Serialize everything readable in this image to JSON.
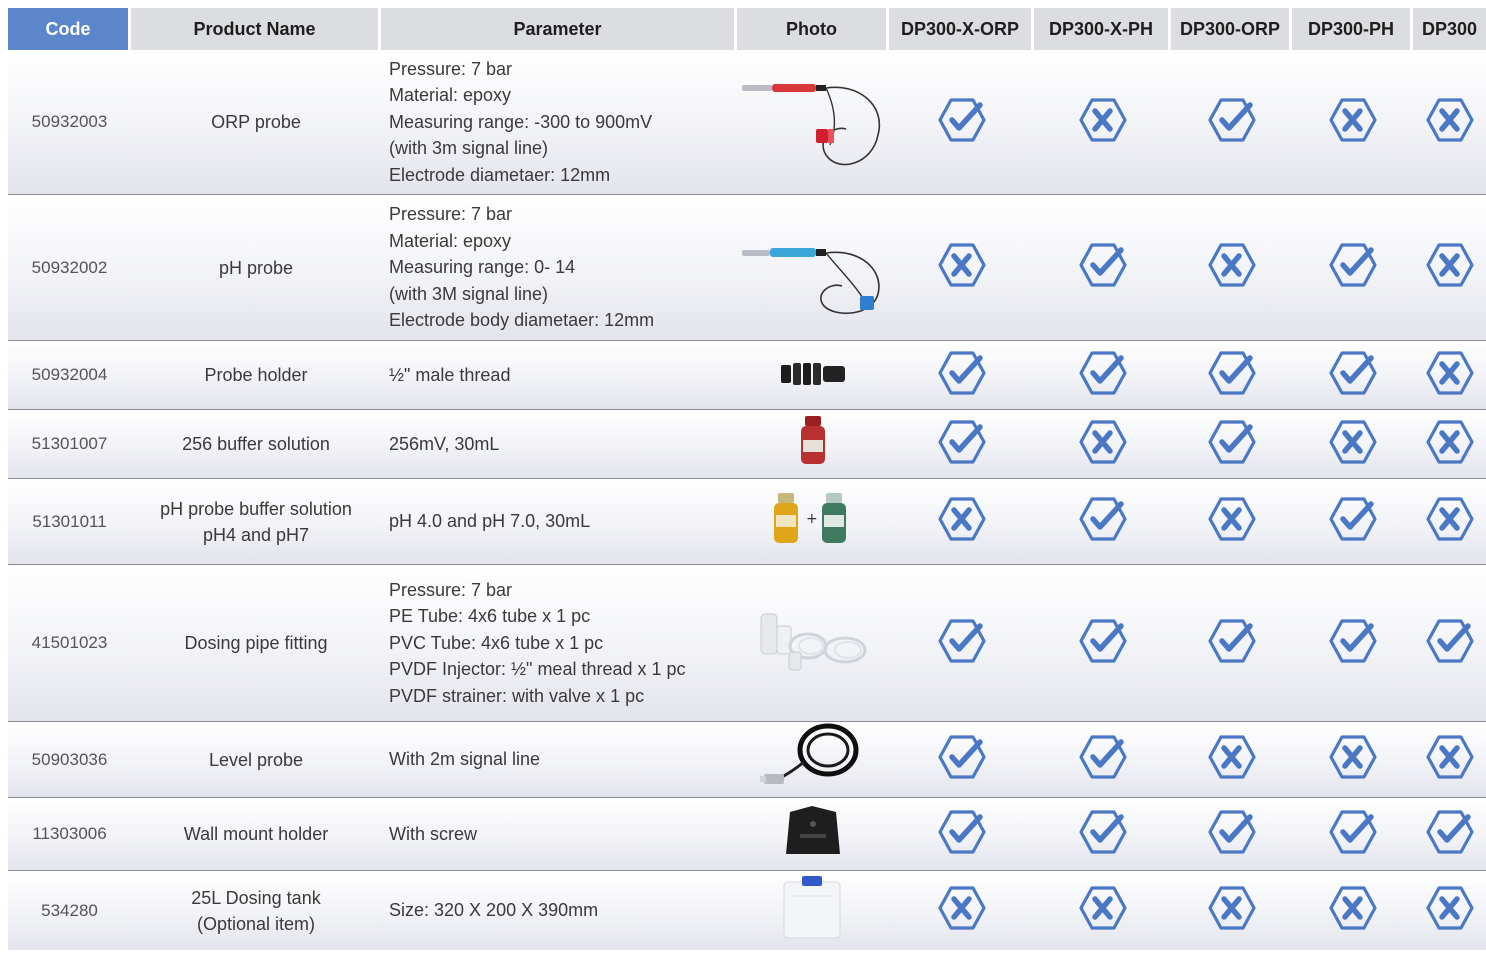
{
  "colors": {
    "accent": "#5b86cc",
    "header_bg": "#dcdde0",
    "icon": "#4a78c4",
    "divider": "#8a8c94"
  },
  "table": {
    "headers": {
      "code": "Code",
      "name": "Product Name",
      "param": "Parameter",
      "photo": "Photo",
      "m1": "DP300-X-ORP",
      "m2": "DP300-X-PH",
      "m3": "DP300-ORP",
      "m4": "DP300-PH",
      "m5": "DP300"
    },
    "rows": [
      {
        "code": "50932003",
        "name": [
          "ORP probe"
        ],
        "params": [
          "Pressure: 7 bar",
          "Material: epoxy",
          "Measuring range: -300 to 900mV",
          "(with 3m signal line)",
          "Electrode diametaer: 12mm"
        ],
        "photo": "orp-probe-image",
        "marks": [
          "check",
          "cross",
          "check",
          "cross",
          "cross"
        ]
      },
      {
        "code": "50932002",
        "name": [
          "pH probe"
        ],
        "params": [
          "Pressure: 7 bar",
          "Material: epoxy",
          "Measuring range: 0- 14",
          "(with 3M signal line)",
          "Electrode body diametaer: 12mm"
        ],
        "photo": "ph-probe-image",
        "marks": [
          "cross",
          "check",
          "cross",
          "check",
          "cross"
        ]
      },
      {
        "code": "50932004",
        "name": [
          "Probe holder"
        ],
        "params": [
          "½\" male thread"
        ],
        "photo": "probe-holder-image",
        "marks": [
          "check",
          "check",
          "check",
          "check",
          "cross"
        ]
      },
      {
        "code": "51301007",
        "name": [
          "256 buffer solution"
        ],
        "params": [
          "256mV, 30mL"
        ],
        "photo": "buffer-bottle-image",
        "marks": [
          "check",
          "cross",
          "check",
          "cross",
          "cross"
        ]
      },
      {
        "code": "51301011",
        "name": [
          "pH probe buffer solution",
          "pH4 and pH7"
        ],
        "params": [
          "pH 4.0 and pH 7.0, 30mL"
        ],
        "photo": "ph-buffer-bottles-image",
        "marks": [
          "cross",
          "check",
          "cross",
          "check",
          "cross"
        ]
      },
      {
        "code": "41501023",
        "name": [
          "Dosing pipe fitting"
        ],
        "params": [
          "Pressure: 7 bar",
          "PE Tube: 4x6 tube x 1 pc",
          "PVC Tube: 4x6 tube x 1 pc",
          "PVDF Injector: ½\" meal thread x 1 pc",
          "PVDF strainer: with valve x 1 pc"
        ],
        "photo": "pipe-fitting-image",
        "marks": [
          "check",
          "check",
          "check",
          "check",
          "check"
        ]
      },
      {
        "code": "50903036",
        "name": [
          "Level probe"
        ],
        "params": [
          "With 2m signal line"
        ],
        "photo": "level-probe-image",
        "marks": [
          "check",
          "check",
          "cross",
          "cross",
          "cross"
        ]
      },
      {
        "code": "11303006",
        "name": [
          "Wall mount holder"
        ],
        "params": [
          "With screw"
        ],
        "photo": "wall-mount-image",
        "marks": [
          "check",
          "check",
          "check",
          "check",
          "check"
        ]
      },
      {
        "code": "534280",
        "name": [
          "25L Dosing tank",
          "(Optional item)"
        ],
        "params": [
          "Size: 320 X 200 X 390mm"
        ],
        "photo": "dosing-tank-image",
        "marks": [
          "cross",
          "cross",
          "cross",
          "cross",
          "cross"
        ]
      }
    ]
  }
}
